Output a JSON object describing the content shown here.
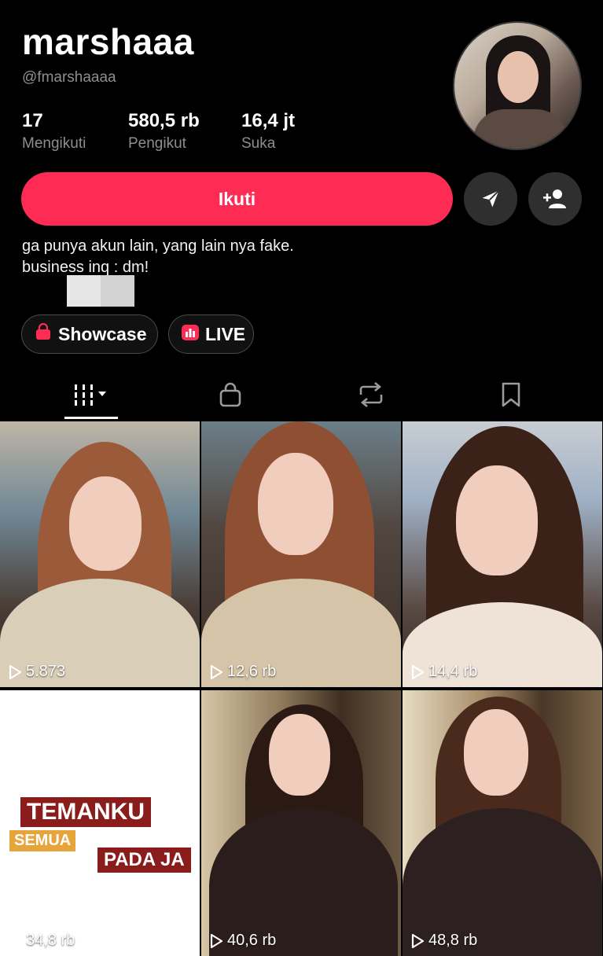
{
  "profile": {
    "display_name": "marshaaa",
    "username": "@fmarshaaaa",
    "bio_line1": "ga punya akun lain, yang lain nya fake.",
    "bio_line2": "business inq : dm!"
  },
  "stats": [
    {
      "value": "17",
      "label": "Mengikuti"
    },
    {
      "value": "580,5 rb",
      "label": "Pengikut"
    },
    {
      "value": "16,4 jt",
      "label": "Suka"
    }
  ],
  "actions": {
    "follow_label": "Ikuti",
    "message_icon": "send-icon",
    "add_friend_icon": "add-user-icon"
  },
  "pills": [
    {
      "label": "Showcase",
      "icon": "shopping-bag-icon"
    },
    {
      "label": "LIVE",
      "icon": "live-icon"
    }
  ],
  "tabs": [
    {
      "icon": "videos-grid-icon",
      "active": true
    },
    {
      "icon": "shop-icon",
      "active": false
    },
    {
      "icon": "repost-icon",
      "active": false
    },
    {
      "icon": "bookmark-icon",
      "active": false
    }
  ],
  "videos": [
    {
      "views": "5.873"
    },
    {
      "views": "12,6 rb"
    },
    {
      "views": "14,4 rb"
    },
    {
      "views": "34,8 rb",
      "overlay_line1": "TEMANKU",
      "overlay_line2": "SEMUA",
      "overlay_line3": "PADA JA"
    },
    {
      "views": "40,6 rb"
    },
    {
      "views": "48,8 rb"
    }
  ],
  "colors": {
    "accent": "#fe2c55",
    "background": "#000000",
    "secondary_text": "#8e8e8e"
  }
}
